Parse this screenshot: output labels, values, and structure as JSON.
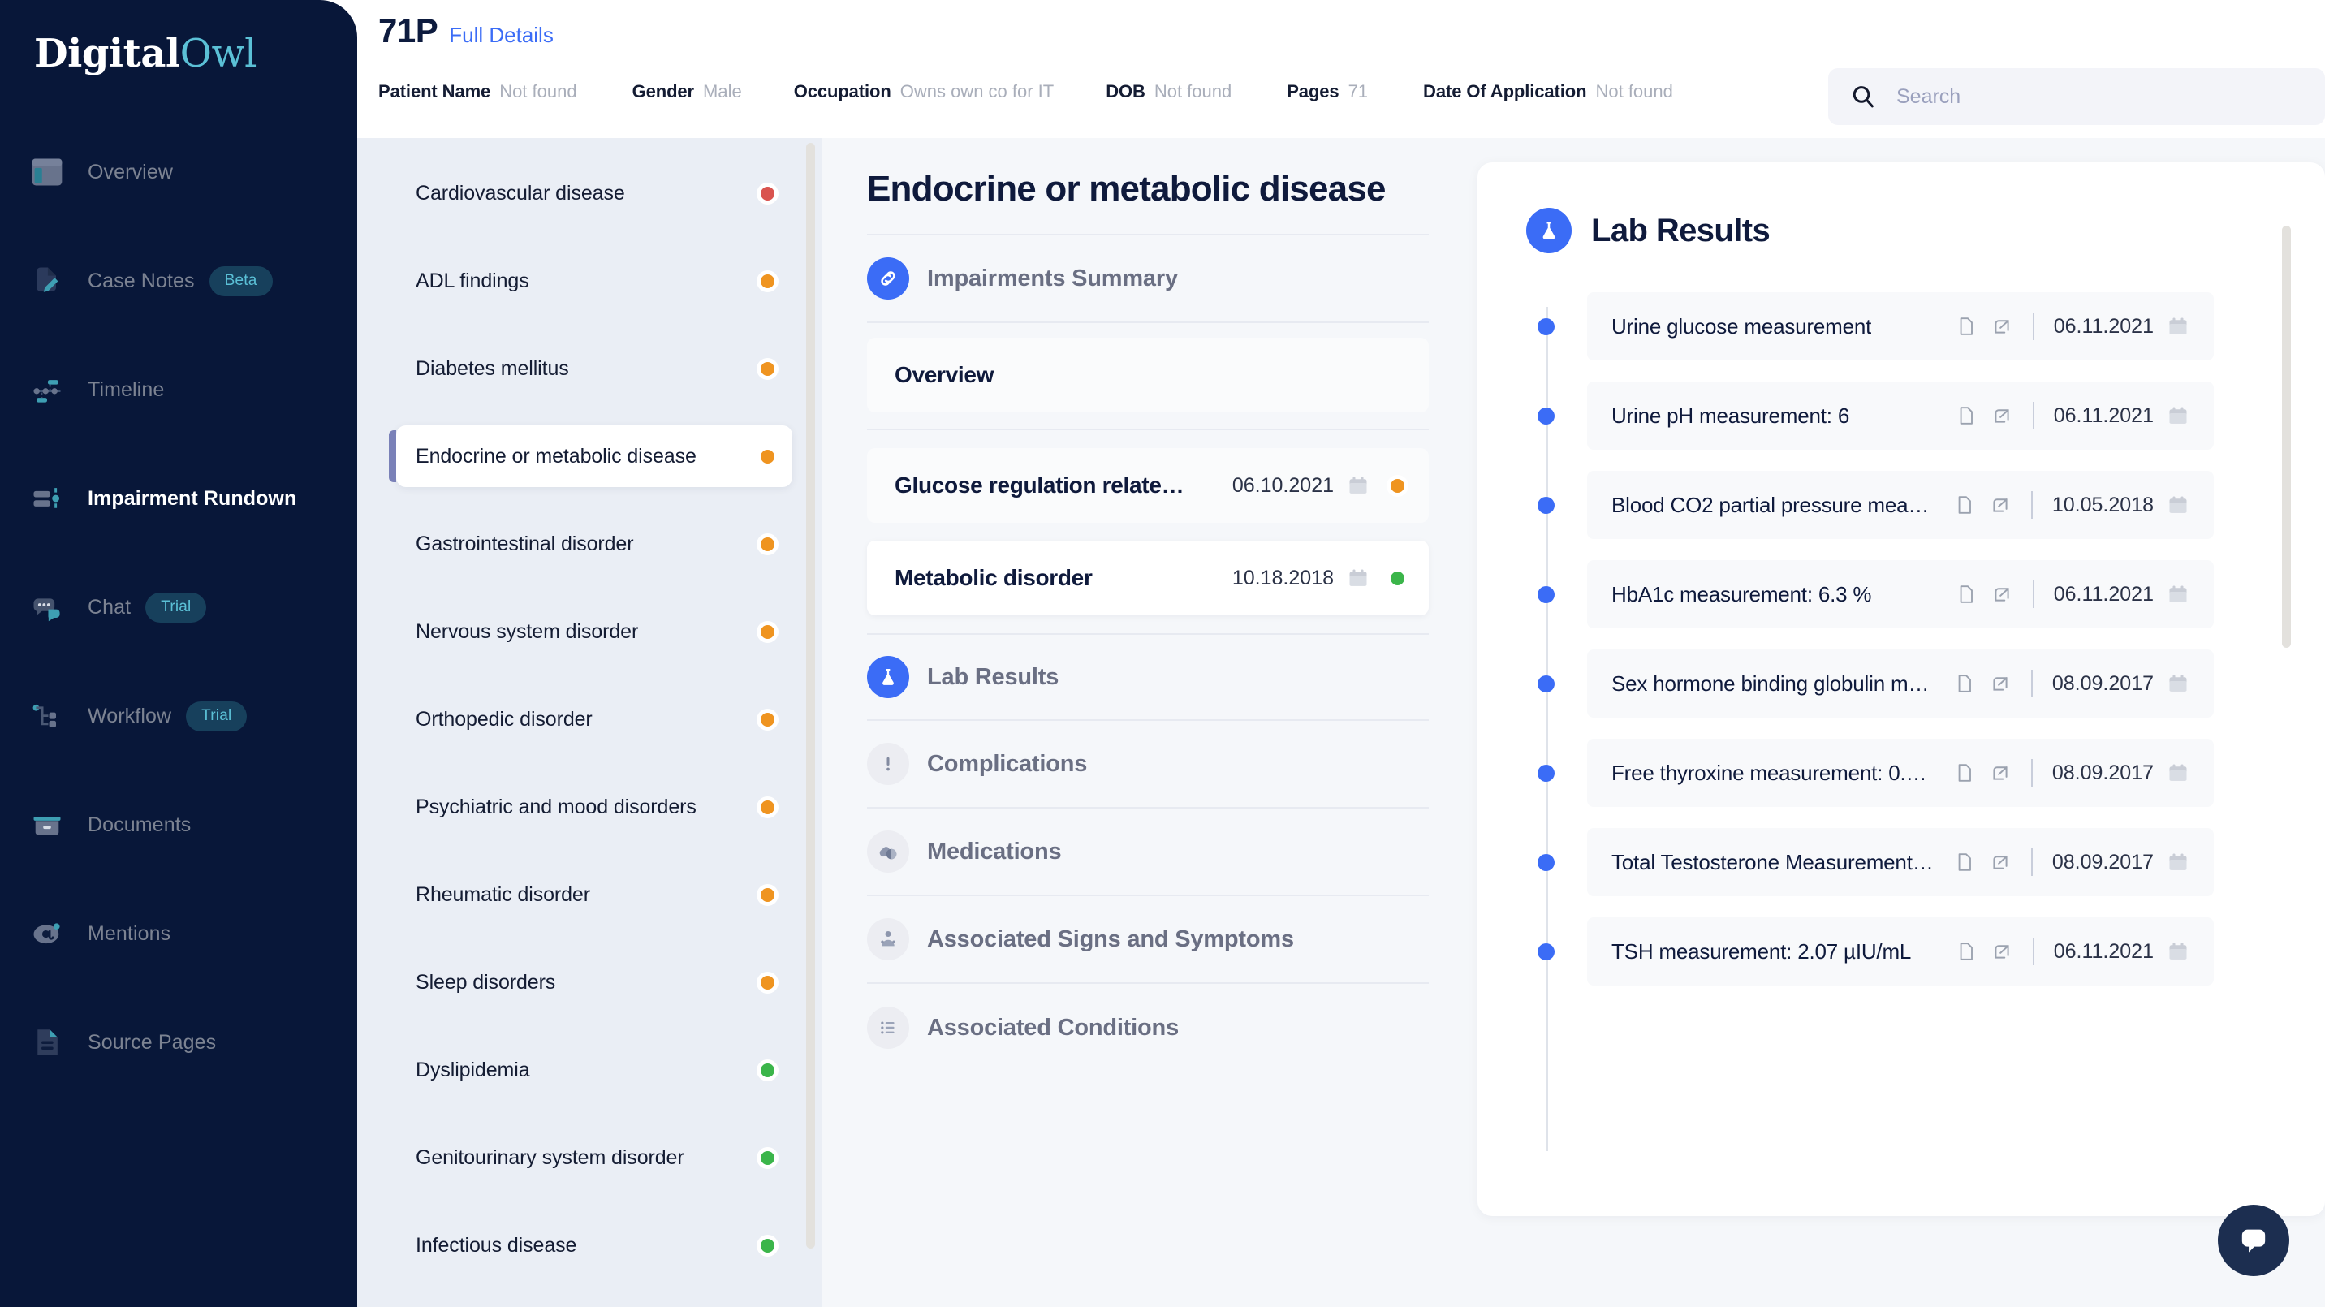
{
  "brand": {
    "name_part1": "Digital",
    "name_part2": "Owl"
  },
  "sidebar": {
    "items": [
      {
        "label": "Overview",
        "icon": "layout-icon",
        "badge": null,
        "active": false
      },
      {
        "label": "Case Notes",
        "icon": "note-edit-icon",
        "badge": "Beta",
        "active": false
      },
      {
        "label": "Timeline",
        "icon": "timeline-icon",
        "badge": null,
        "active": false
      },
      {
        "label": "Impairment Rundown",
        "icon": "rundown-icon",
        "badge": null,
        "active": true
      },
      {
        "label": "Chat",
        "icon": "chat-icon",
        "badge": "Trial",
        "active": false
      },
      {
        "label": "Workflow",
        "icon": "workflow-icon",
        "badge": "Trial",
        "active": false
      },
      {
        "label": "Documents",
        "icon": "archive-icon",
        "badge": null,
        "active": false
      },
      {
        "label": "Mentions",
        "icon": "at-icon",
        "badge": null,
        "active": false
      },
      {
        "label": "Source Pages",
        "icon": "document-icon",
        "badge": null,
        "active": false
      }
    ]
  },
  "header": {
    "case_id": "71P",
    "full_details_link": "Full Details",
    "meta": [
      {
        "key": "Patient Name",
        "value": "Not found"
      },
      {
        "key": "Gender",
        "value": "Male"
      },
      {
        "key": "Occupation",
        "value": "Owns own co for IT"
      },
      {
        "key": "DOB",
        "value": "Not found"
      },
      {
        "key": "Pages",
        "value": "71"
      },
      {
        "key": "Date Of Application",
        "value": "Not found"
      }
    ],
    "search_placeholder": "Search",
    "search_value": ""
  },
  "impairment_list": [
    {
      "label": "Cardiovascular disease",
      "severity": "red",
      "selected": false
    },
    {
      "label": "ADL findings",
      "severity": "orange",
      "selected": false
    },
    {
      "label": "Diabetes mellitus",
      "severity": "orange",
      "selected": false
    },
    {
      "label": "Endocrine or metabolic disease",
      "severity": "orange",
      "selected": true
    },
    {
      "label": "Gastrointestinal disorder",
      "severity": "orange",
      "selected": false
    },
    {
      "label": "Nervous system disorder",
      "severity": "orange",
      "selected": false
    },
    {
      "label": "Orthopedic disorder",
      "severity": "orange",
      "selected": false
    },
    {
      "label": "Psychiatric and mood disorders",
      "severity": "orange",
      "selected": false
    },
    {
      "label": "Rheumatic disorder",
      "severity": "orange",
      "selected": false
    },
    {
      "label": "Sleep disorders",
      "severity": "orange",
      "selected": false
    },
    {
      "label": "Dyslipidemia",
      "severity": "green",
      "selected": false
    },
    {
      "label": "Genitourinary system disorder",
      "severity": "green",
      "selected": false
    },
    {
      "label": "Infectious disease",
      "severity": "green",
      "selected": false
    }
  ],
  "detail": {
    "title": "Endocrine or metabolic disease",
    "summary_section": {
      "label": "Impairments Summary",
      "icon": "link-circle-icon",
      "active": true,
      "overview_label": "Overview",
      "items": [
        {
          "name": "Glucose regulation relate…",
          "date": "06.10.2021",
          "severity": "orange",
          "highlight": false
        },
        {
          "name": "Metabolic disorder",
          "date": "10.18.2018",
          "severity": "green",
          "highlight": true
        }
      ]
    },
    "sections": [
      {
        "label": "Lab Results",
        "icon": "flask-icon",
        "active": true
      },
      {
        "label": "Complications",
        "icon": "alert-icon",
        "active": false
      },
      {
        "label": "Medications",
        "icon": "pills-icon",
        "active": false
      },
      {
        "label": "Associated Signs and Symptoms",
        "icon": "person-icon",
        "active": false
      },
      {
        "label": "Associated Conditions",
        "icon": "list-icon",
        "active": false
      }
    ]
  },
  "lab_results": {
    "title": "Lab Results",
    "icon": "flask-icon",
    "items": [
      {
        "name": "Urine glucose measurement",
        "date": "06.11.2021"
      },
      {
        "name": "Urine pH measurement: 6",
        "date": "06.11.2021"
      },
      {
        "name": "Blood CO2 partial pressure mea…",
        "date": "10.05.2018"
      },
      {
        "name": "HbA1c measurement: 6.3 %",
        "date": "06.11.2021"
      },
      {
        "name": "Sex hormone binding globulin m…",
        "date": "08.09.2017"
      },
      {
        "name": "Free thyroxine measurement: 0.…",
        "date": "08.09.2017"
      },
      {
        "name": "Total Testosterone Measurement…",
        "date": "08.09.2017"
      },
      {
        "name": "TSH measurement: 2.07 µIU/mL",
        "date": "06.11.2021"
      }
    ]
  },
  "chat_fab": {
    "icon": "chat-bubble-icon"
  },
  "colors": {
    "sidebar_bg": "#081739",
    "brand_accent": "#5bc0d6",
    "link": "#3b6cf6",
    "severity_red": "#d9534f",
    "severity_orange": "#ef9420",
    "severity_green": "#3bb54a",
    "panel_bg": "#f5f7fa",
    "list_bg": "#eaeef5"
  }
}
